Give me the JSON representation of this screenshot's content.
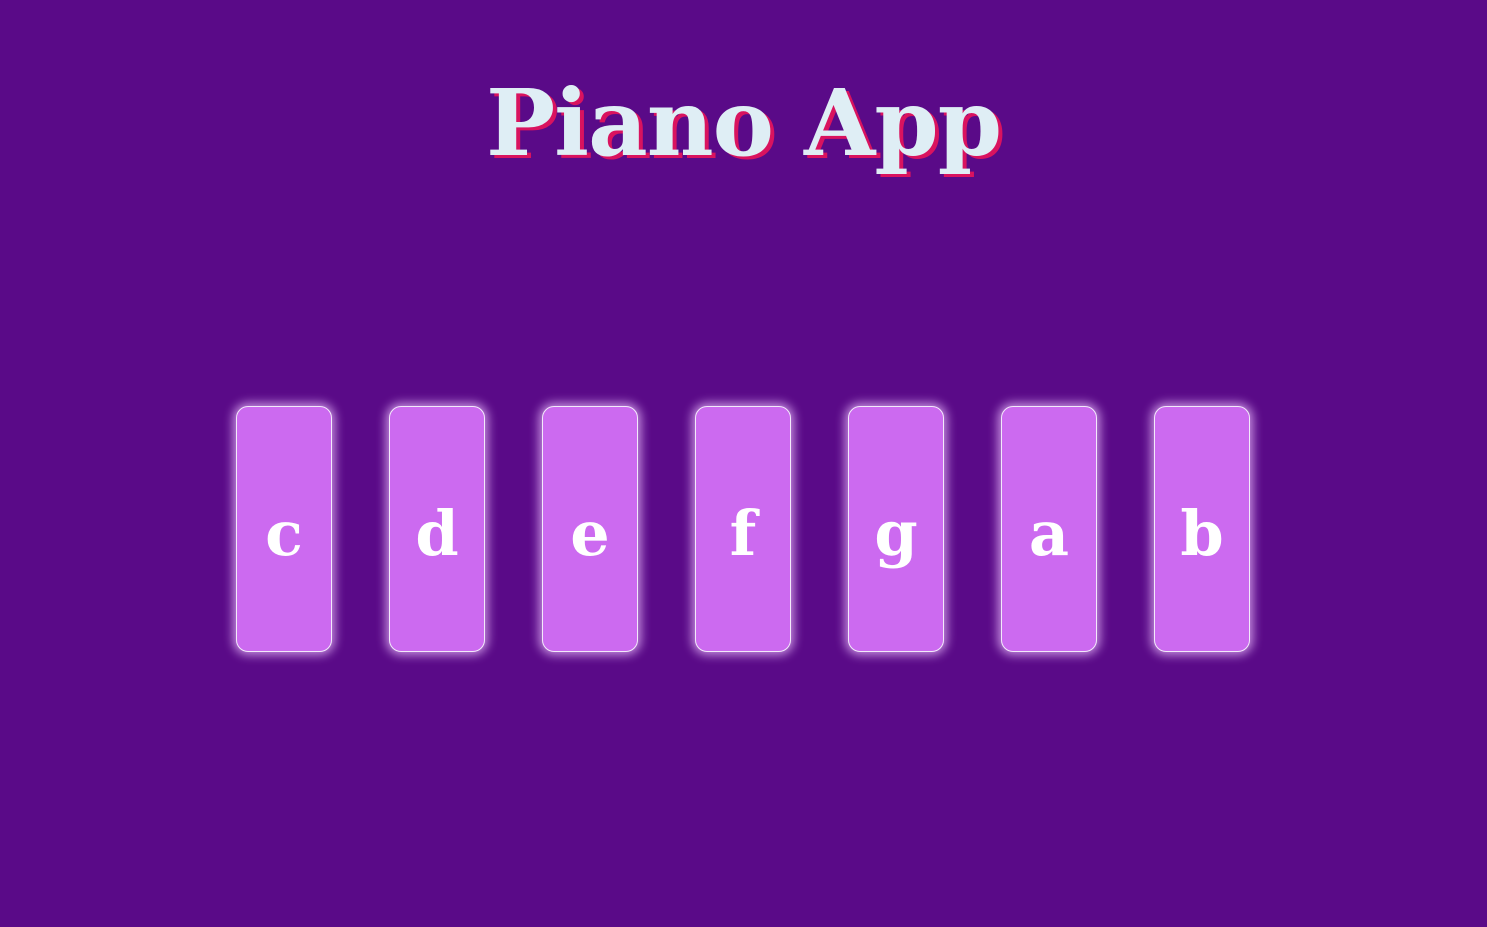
{
  "app": {
    "title": "Piano App"
  },
  "keys": [
    {
      "label": "c"
    },
    {
      "label": "d"
    },
    {
      "label": "e"
    },
    {
      "label": "f"
    },
    {
      "label": "g"
    },
    {
      "label": "a"
    },
    {
      "label": "b"
    }
  ],
  "colors": {
    "background": "#5a0a88",
    "key_fill": "#cc6af0",
    "title_text": "#dfeef5",
    "title_shadow": "#d9135f",
    "key_text": "#ffffff"
  }
}
